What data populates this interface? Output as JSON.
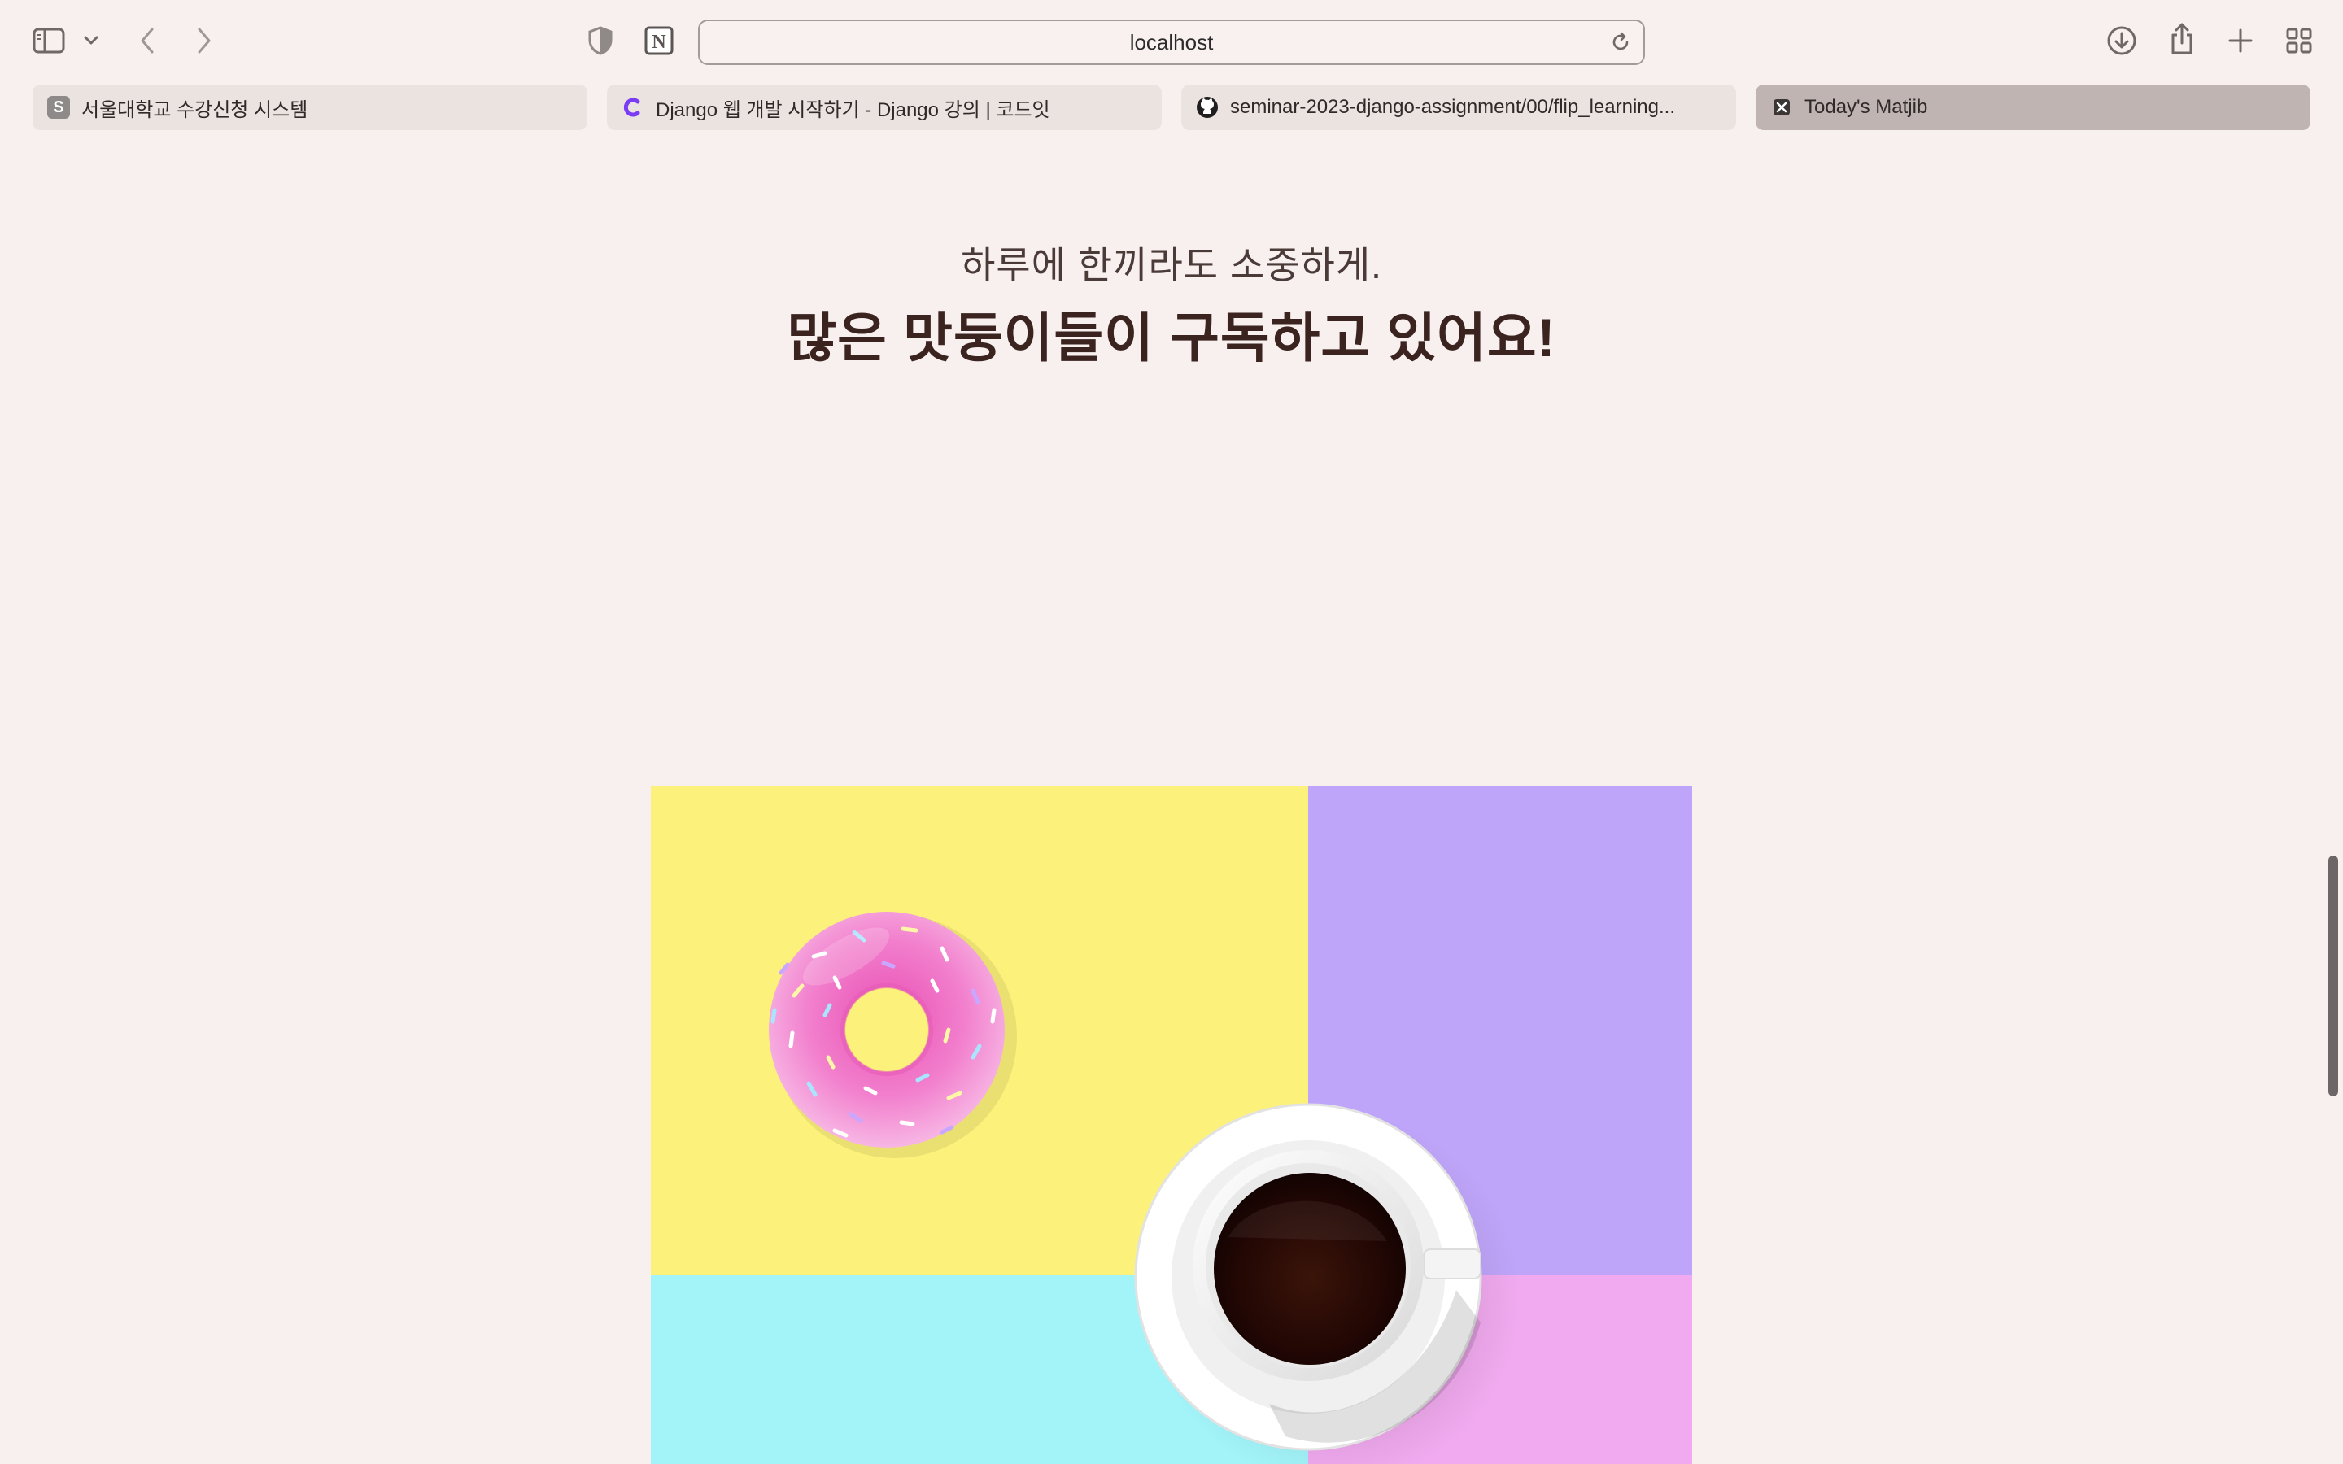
{
  "browser": {
    "url": "localhost",
    "tabs": [
      {
        "title": "서울대학교 수강신청 시스템",
        "favicon": "S"
      },
      {
        "title": "Django 웹 개발 시작하기 - Django 강의 | 코드잇"
      },
      {
        "title": "seminar-2023-django-assignment/00/flip_learning..."
      },
      {
        "title": "Today's Matjib",
        "active": true
      }
    ],
    "icons": {
      "sidebar": "sidebar-icon",
      "sidebar_menu": "chevron-down-icon",
      "back": "chevron-left-icon",
      "forward": "chevron-right-icon",
      "privacy": "shield-icon",
      "notion": "notion-icon",
      "reload": "reload-icon",
      "downloads": "download-icon",
      "share": "share-icon",
      "new_tab": "plus-icon",
      "tab_overview": "grid-icon"
    }
  },
  "page": {
    "subtitle": "하루에 한끼라도 소중하게.",
    "headline": "많은 맛둥이들이 구독하고 있어요!",
    "hero": {
      "image": "donut-and-coffee-illustration",
      "colors": {
        "yellow": "#fcf27b",
        "purple": "#bfa5f9",
        "cyan": "#a2f4f9",
        "pink": "#f1aaef",
        "donut_frosting": "#f06fc3",
        "coffee": "#2a0b06"
      }
    }
  }
}
